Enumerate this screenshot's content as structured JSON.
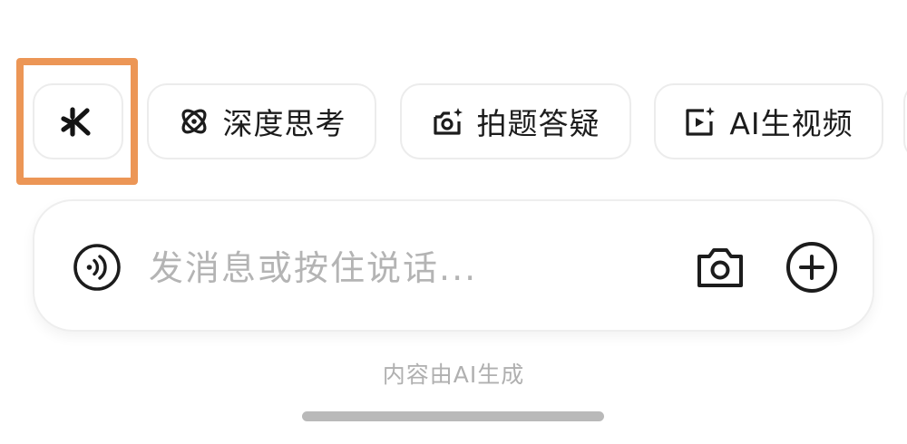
{
  "chips": [
    {
      "label": "",
      "icon": "sparkle-logo-icon"
    },
    {
      "label": "深度思考",
      "icon": "atom-orbit-icon"
    },
    {
      "label": "拍题答疑",
      "icon": "camera-sparkle-icon"
    },
    {
      "label": "AI生视频",
      "icon": "video-sparkle-icon"
    }
  ],
  "highlight_color": "#ec9656",
  "input": {
    "placeholder": "发消息或按住说话...",
    "value": "",
    "voice_icon": "voice-wave-icon",
    "camera_icon": "camera-icon",
    "add_icon": "plus-circle-icon"
  },
  "disclaimer": "内容由AI生成"
}
